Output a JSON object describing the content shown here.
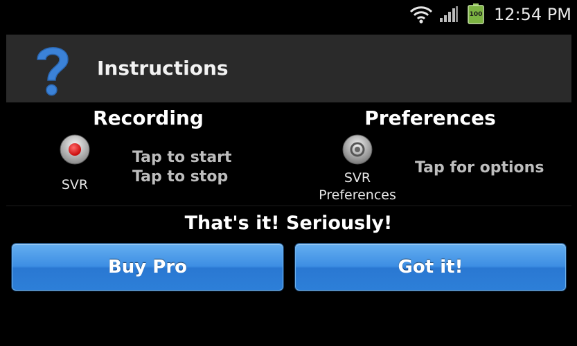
{
  "status_bar": {
    "time": "12:54 PM",
    "battery_level": "100",
    "icons": [
      "wifi-icon",
      "signal-icon",
      "battery-icon"
    ]
  },
  "dialog": {
    "title": "Instructions",
    "icon": "help-icon"
  },
  "recording": {
    "title": "Recording",
    "icon": "record-icon",
    "icon_label": "SVR",
    "hint_start": "Tap to start",
    "hint_stop": "Tap to stop"
  },
  "preferences": {
    "title": "Preferences",
    "icon": "settings-icon",
    "icon_label_line1": "SVR",
    "icon_label_line2": "Preferences",
    "hint": "Tap for options"
  },
  "tagline": "That's it! Seriously!",
  "buttons": {
    "buy_label": "Buy Pro",
    "got_label": "Got it!"
  },
  "colors": {
    "button_blue": "#3d8ee3",
    "help_blue": "#3b82d8",
    "record_red": "#e00000",
    "header_bg": "#2a2a2a",
    "battery_green": "#8bc34a"
  }
}
